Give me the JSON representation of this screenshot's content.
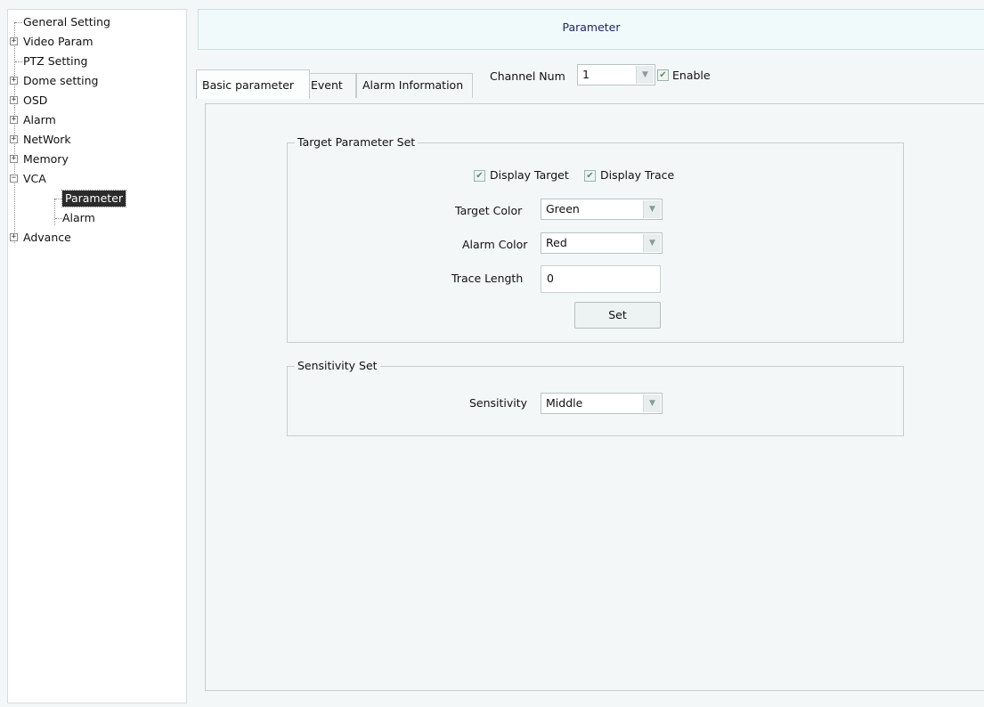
{
  "tree": {
    "items": [
      {
        "label": "General Setting",
        "expander": ""
      },
      {
        "label": "Video Param",
        "expander": "+"
      },
      {
        "label": "PTZ Setting",
        "expander": ""
      },
      {
        "label": "Dome setting",
        "expander": "+"
      },
      {
        "label": "OSD",
        "expander": "+"
      },
      {
        "label": "Alarm",
        "expander": "+"
      },
      {
        "label": "NetWork",
        "expander": "+"
      },
      {
        "label": "Memory",
        "expander": "+"
      },
      {
        "label": "VCA",
        "expander": "−"
      },
      {
        "label": "Parameter",
        "expander": ""
      },
      {
        "label": "Alarm",
        "expander": ""
      },
      {
        "label": "Advance",
        "expander": "+"
      }
    ]
  },
  "header": {
    "title": "Parameter"
  },
  "tabs": [
    {
      "label": "Basic parameter",
      "active": true
    },
    {
      "label": "Event",
      "active": false
    },
    {
      "label": "Alarm Information",
      "active": false
    }
  ],
  "channel": {
    "label": "Channel Num",
    "value": "1",
    "enable_label": "Enable",
    "enable_checked": true
  },
  "target_group": {
    "title": "Target Parameter Set",
    "display_target_label": "Display Target",
    "display_trace_label": "Display Trace",
    "target_color_label": "Target Color",
    "target_color_value": "Green",
    "alarm_color_label": "Alarm Color",
    "alarm_color_value": "Red",
    "trace_length_label": "Trace Length",
    "trace_length_value": "0",
    "set_label": "Set"
  },
  "sensitivity_group": {
    "title": "Sensitivity Set",
    "sensitivity_label": "Sensitivity",
    "sensitivity_value": "Middle"
  },
  "icons": {
    "check": "check-icon",
    "dropdown": "chevron-down-icon"
  }
}
